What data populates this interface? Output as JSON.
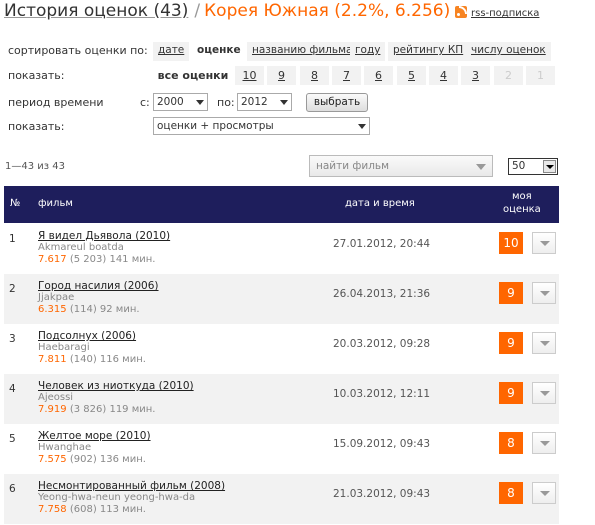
{
  "header": {
    "history_label": "История оценок (43)",
    "separator": "/",
    "country_label": "Корея Южная (2.2%, 6.256)",
    "rss_label": "rss-подписка"
  },
  "sort": {
    "label": "сортировать оценки по:",
    "options": [
      "дате",
      "оценке",
      "названию фильма",
      "году",
      "рейтингу КП",
      "числу оценок"
    ],
    "active": "оценке"
  },
  "show_filter": {
    "label": "показать:",
    "options": [
      "все оценки",
      "10",
      "9",
      "8",
      "7",
      "6",
      "5",
      "4",
      "3",
      "2",
      "1"
    ],
    "active": "все оценки",
    "disabled": [
      "2",
      "1"
    ]
  },
  "period": {
    "label": "период времени",
    "from_label": "с:",
    "from_value": "2000",
    "to_label": "по:",
    "to_value": "2012",
    "button": "выбрать"
  },
  "show_type": {
    "label": "показать:",
    "value": "оценки + просмотры"
  },
  "results": {
    "count": "1—43 из 43",
    "find_placeholder": "найти фильм",
    "per_page": "50"
  },
  "table": {
    "headers": {
      "num": "№",
      "film": "фильм",
      "date": "дата и время",
      "my_rating_1": "моя",
      "my_rating_2": "оценка"
    },
    "rows": [
      {
        "num": "1",
        "title": "Я видел Дьявола (2010)",
        "orig": "Akmareul boatda",
        "rating": "7.617",
        "votes": "(5 203)",
        "duration": "141 мин.",
        "date": "27.01.2012, 20:44",
        "score": "10"
      },
      {
        "num": "2",
        "title": "Город насилия (2006)",
        "orig": "Jjakpae",
        "rating": "6.315",
        "votes": "(114)",
        "duration": "92 мин.",
        "date": "26.04.2013, 21:36",
        "score": "9"
      },
      {
        "num": "3",
        "title": "Подсолнух (2006)",
        "orig": "Haebaragi",
        "rating": "7.811",
        "votes": "(140)",
        "duration": "116 мин.",
        "date": "20.03.2012, 09:28",
        "score": "9"
      },
      {
        "num": "4",
        "title": "Человек из ниоткуда (2010)",
        "orig": "Ajeossi",
        "rating": "7.919",
        "votes": "(3 826)",
        "duration": "119 мин.",
        "date": "10.03.2012, 12:11",
        "score": "9"
      },
      {
        "num": "5",
        "title": "Желтое море (2010)",
        "orig": "Hwanghae",
        "rating": "7.575",
        "votes": "(902)",
        "duration": "136 мин.",
        "date": "15.09.2012, 09:43",
        "score": "8"
      },
      {
        "num": "6",
        "title": "Несмонтированный фильм (2008)",
        "orig": "Yeong-hwa-neun yeong-hwa-da",
        "rating": "7.758",
        "votes": "(608)",
        "duration": "113 мин.",
        "date": "21.03.2012, 09:43",
        "score": "8"
      }
    ]
  },
  "colors": {
    "accent": "#ff6600",
    "table_header": "#1e1e5c",
    "row_shade": "#f2f2f2"
  }
}
